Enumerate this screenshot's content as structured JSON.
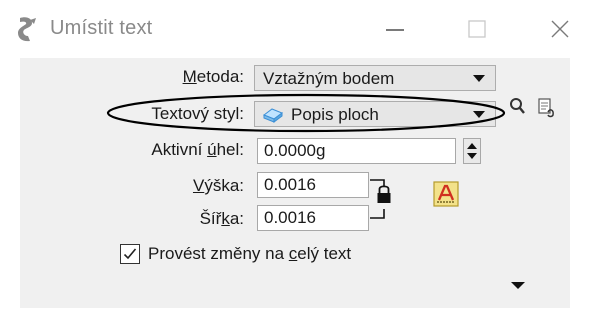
{
  "window": {
    "title": "Umístit text",
    "app_icon": "microstation-tool-icon",
    "controls": {
      "minimize": "minimize-icon",
      "maximize": "maximize-icon",
      "close": "close-icon"
    }
  },
  "form": {
    "method": {
      "label_pre": "",
      "label_u": "M",
      "label_post": "etoda:",
      "value": "Vztažným bodem"
    },
    "text_style": {
      "label": "Textový styl:",
      "value": "Popis ploch",
      "icon": "text-style-icon"
    },
    "angle": {
      "label_pre": "Aktivní ",
      "label_u": "ú",
      "label_post": "hel:",
      "value": "0.0000g"
    },
    "height": {
      "label_pre": "",
      "label_u": "V",
      "label_post": "ýška:",
      "value": "0.0016"
    },
    "width": {
      "label_pre": "Šíř",
      "label_u": "k",
      "label_post": "a:",
      "value": "0.0016"
    },
    "apply_all": {
      "checked": true,
      "label_pre": "Provést změny na ",
      "label_u": "c",
      "label_post": "elý text"
    }
  },
  "colors": {
    "accent_highlight": "#000000",
    "lock_color": "#000000",
    "font_icon_red": "#d03020"
  }
}
